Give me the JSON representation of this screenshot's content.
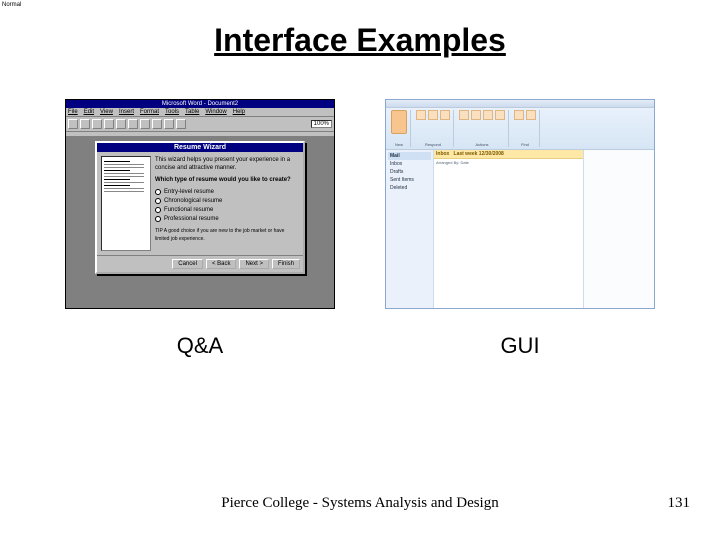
{
  "title": "Interface Examples",
  "left": {
    "label": "Q&A",
    "window_title": "Microsoft Word - Document2",
    "menu": [
      "File",
      "Edit",
      "View",
      "Insert",
      "Format",
      "Tools",
      "Table",
      "Window",
      "Help"
    ],
    "zoom": "100%",
    "view_mode": "Normal",
    "wizard": {
      "title": "Resume Wizard",
      "intro": "This wizard helps you present your experience in a concise and attractive manner.",
      "question": "Which type of resume would you like to create?",
      "options": [
        "Entry-level resume",
        "Chronological resume",
        "Functional resume",
        "Professional resume"
      ],
      "tip": "TIP  A good choice if you are new to the job market or have limited job experience.",
      "buttons": [
        "Cancel",
        "< Back",
        "Next >",
        "Finish"
      ]
    }
  },
  "right": {
    "label": "GUI",
    "ribbon_groups": [
      "New",
      "Respond",
      "Actions",
      "Find"
    ],
    "nav_header": "Mail",
    "nav_items": [
      "Inbox",
      "Drafts",
      "Sent Items",
      "Deleted"
    ],
    "list_header": "Inbox",
    "list_subheader": "Arranged By: Date",
    "date_label": "Last week 12/30/2008"
  },
  "footer": "Pierce College - Systems Analysis and Design",
  "page": "131"
}
